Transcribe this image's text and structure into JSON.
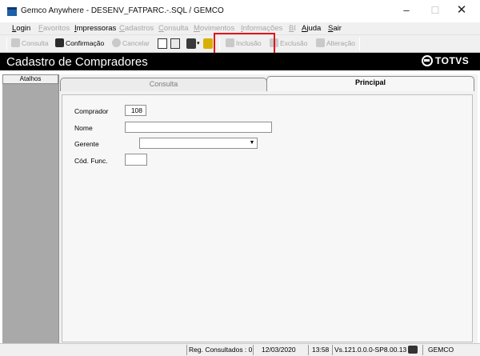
{
  "window": {
    "title": "Gemco Anywhere - DESENV_FATPARC.-.SQL / GEMCO",
    "min_symbol": "–",
    "max_symbol": "☐",
    "close_symbol": "✕"
  },
  "menu": [
    {
      "label": "Login",
      "enabled": true
    },
    {
      "label": "Favoritos",
      "enabled": false
    },
    {
      "label": "Impressoras",
      "enabled": true
    },
    {
      "label": "Cadastros",
      "enabled": false
    },
    {
      "label": "Consulta",
      "enabled": false
    },
    {
      "label": "Movimentos",
      "enabled": false
    },
    {
      "label": "Informações",
      "enabled": false
    },
    {
      "label": "BI",
      "enabled": false
    },
    {
      "label": "Ajuda",
      "enabled": true
    },
    {
      "label": "Sair",
      "enabled": true
    }
  ],
  "toolbar": {
    "consulta": "Consulta",
    "confirmacao": "Confirmação",
    "cancelar": "Cancelar",
    "inclusao": "Inclusão",
    "exclusao": "Exclusão",
    "alteracao": "Alteração",
    "highlight_color": "#e3121b"
  },
  "header": {
    "title": "Cadastro de Compradores",
    "logo_text": "TOTVS"
  },
  "sidebar": {
    "tab_label": "Atalhos"
  },
  "tabs": {
    "consulta": "Consulta",
    "principal": "Principal"
  },
  "form": {
    "comprador_label": "Comprador",
    "comprador_value": "108",
    "nome_label": "Nome",
    "nome_value": "",
    "gerente_label": "Gerente",
    "gerente_value": "",
    "codfunc_label": "Cód. Func.",
    "codfunc_value": ""
  },
  "status": {
    "reg_consultados": "Reg. Consultados : 0",
    "date": "12/03/2020",
    "time": "13:58",
    "version": "Vs.121.0.0.0-SP8.00.13",
    "company": "GEMCO"
  }
}
